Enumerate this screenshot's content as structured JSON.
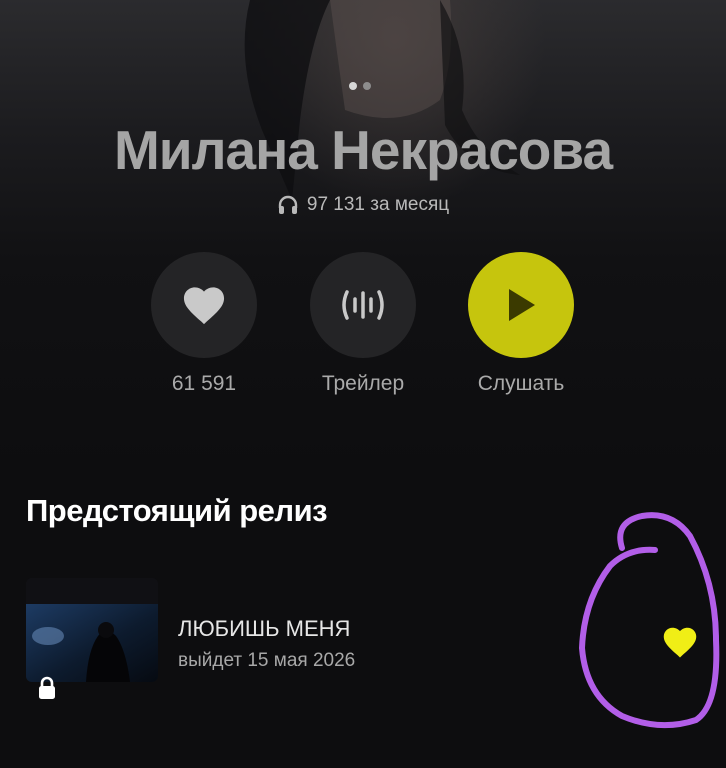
{
  "artist": {
    "name": "Милана Некрасова",
    "monthly_listeners": "97 131 за месяц"
  },
  "carousel": {
    "count": 2,
    "active_index": 0
  },
  "actions": {
    "like": {
      "label": "61 591",
      "icon": "heart-icon"
    },
    "trailer": {
      "label": "Трейлер",
      "icon": "waveform-icon"
    },
    "listen": {
      "label": "Слушать",
      "icon": "play-icon"
    }
  },
  "upcoming": {
    "section_title": "Предстоящий релиз",
    "release": {
      "title": "ЛЮБИШЬ МЕНЯ",
      "subtitle": "выйдет 15 мая 2026",
      "locked": true,
      "like_icon": "heart-icon"
    }
  },
  "colors": {
    "accent_yellow": "#c6c50d",
    "annotation_purple": "#b25ee8",
    "heart_yellow": "#f0ee16",
    "background": "#0d0d0f"
  }
}
